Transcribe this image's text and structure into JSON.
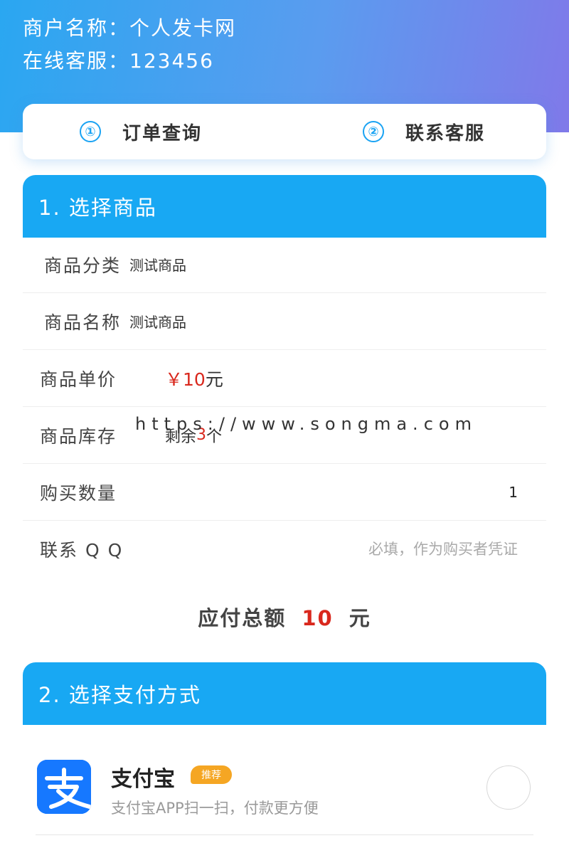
{
  "header": {
    "merchant_line": "商户名称：个人发卡网",
    "service_line": "在线客服：123456"
  },
  "nav": {
    "items": [
      {
        "num": "①",
        "label": "订单查询"
      },
      {
        "num": "②",
        "label": "联系客服"
      }
    ]
  },
  "section1": {
    "title": "1. 选择商品",
    "category": {
      "label": "商品分类",
      "value": "测试商品"
    },
    "name": {
      "label": "商品名称",
      "value": "测试商品"
    },
    "price": {
      "label": "商品单价",
      "value": "￥10",
      "unit": "元"
    },
    "stock": {
      "label": "商品库存",
      "value_prefix": "剩余",
      "value_num": "3",
      "value_suffix": "个"
    },
    "quantity": {
      "label": "购买数量",
      "value": "1"
    },
    "qq": {
      "label": "联系 Q Q",
      "placeholder": "必填，作为购买者凭证"
    }
  },
  "watermark": "https://www.songma.com",
  "total": {
    "label": "应付总额",
    "amount": "10",
    "unit": "元"
  },
  "section2": {
    "title": "2. 选择支付方式",
    "alipay": {
      "name": "支付宝",
      "badge": "推荐",
      "desc": "支付宝APP扫一扫，付款更方便",
      "icon": "alipay-icon"
    }
  },
  "colors": {
    "accent": "#18a8f3",
    "price": "#d9281d",
    "badge": "#f5a623",
    "alipay": "#1678ff"
  }
}
